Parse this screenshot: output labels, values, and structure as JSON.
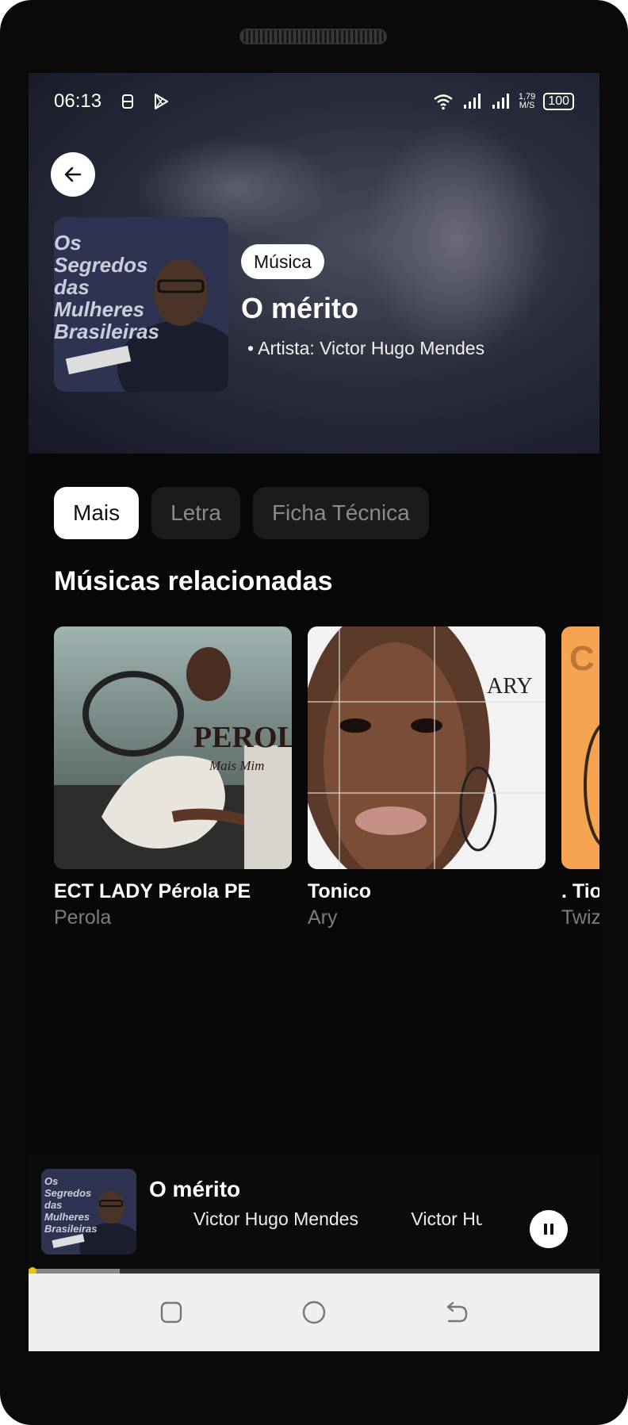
{
  "status_bar": {
    "time": "06:13",
    "net_speed_value": "1,79",
    "net_speed_unit": "M/S",
    "battery": "100"
  },
  "header": {
    "category_badge": "Música",
    "title": "O mérito",
    "artist_line": "• Artista: Victor Hugo Mendes",
    "cover_text": [
      "Os Segredos",
      "das Mulheres",
      "Brasileiras"
    ]
  },
  "tabs": [
    {
      "label": "Mais",
      "active": true
    },
    {
      "label": "Letra",
      "active": false
    },
    {
      "label": "Ficha Técnica",
      "active": false
    }
  ],
  "related": {
    "title": "Músicas relacionadas",
    "items": [
      {
        "title": "ECT LADY         Pérola  PE",
        "artist": "Perola",
        "cover_text": "PEROLA",
        "cover_subtext": "Mais Mim"
      },
      {
        "title": "Tonico",
        "artist": "Ary",
        "cover_text": "ARY"
      },
      {
        "title": ". Tio",
        "artist": "Twiz",
        "cover_text": "C"
      }
    ]
  },
  "mini_player": {
    "title": "O mérito",
    "artist": "Victor Hugo Mendes",
    "artist_repeat": "Victor Hug",
    "progress": 0.16
  },
  "colors": {
    "accent_knob": "#f5c400",
    "background": "#080808"
  }
}
